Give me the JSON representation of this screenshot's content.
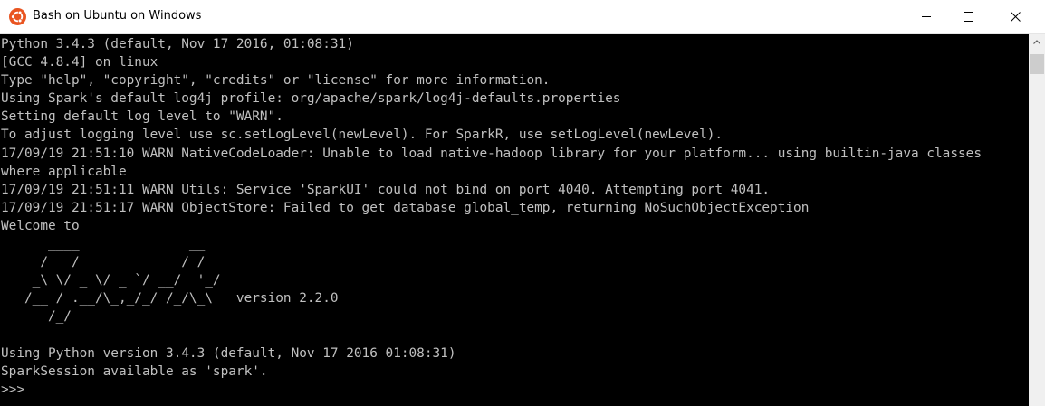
{
  "window": {
    "title": "Bash on Ubuntu on Windows",
    "icon": "ubuntu-logo-icon",
    "accent": "#e95420",
    "controls": [
      "minimize-icon",
      "maximize-icon",
      "close-icon"
    ]
  },
  "console": {
    "background": "#000000",
    "foreground": "#c0c0c0",
    "lines": [
      "Python 3.4.3 (default, Nov 17 2016, 01:08:31)",
      "[GCC 4.8.4] on linux",
      "Type \"help\", \"copyright\", \"credits\" or \"license\" for more information.",
      "Using Spark's default log4j profile: org/apache/spark/log4j-defaults.properties",
      "Setting default log level to \"WARN\".",
      "To adjust logging level use sc.setLogLevel(newLevel). For SparkR, use setLogLevel(newLevel).",
      "17/09/19 21:51:10 WARN NativeCodeLoader: Unable to load native-hadoop library for your platform... using builtin-java classes",
      "where applicable",
      "17/09/19 21:51:11 WARN Utils: Service 'SparkUI' could not bind on port 4040. Attempting port 4041.",
      "17/09/19 21:51:17 WARN ObjectStore: Failed to get database global_temp, returning NoSuchObjectException",
      "Welcome to",
      "      ____              __",
      "     / __/__  ___ _____/ /__",
      "    _\\ \\/ _ \\/ _ `/ __/  '_/",
      "   /__ / .__/\\_,_/_/ /_/\\_\\   version 2.2.0",
      "      /_/",
      "",
      "Using Python version 3.4.3 (default, Nov 17 2016 01:08:31)",
      "SparkSession available as 'spark'.",
      ">>>"
    ]
  }
}
